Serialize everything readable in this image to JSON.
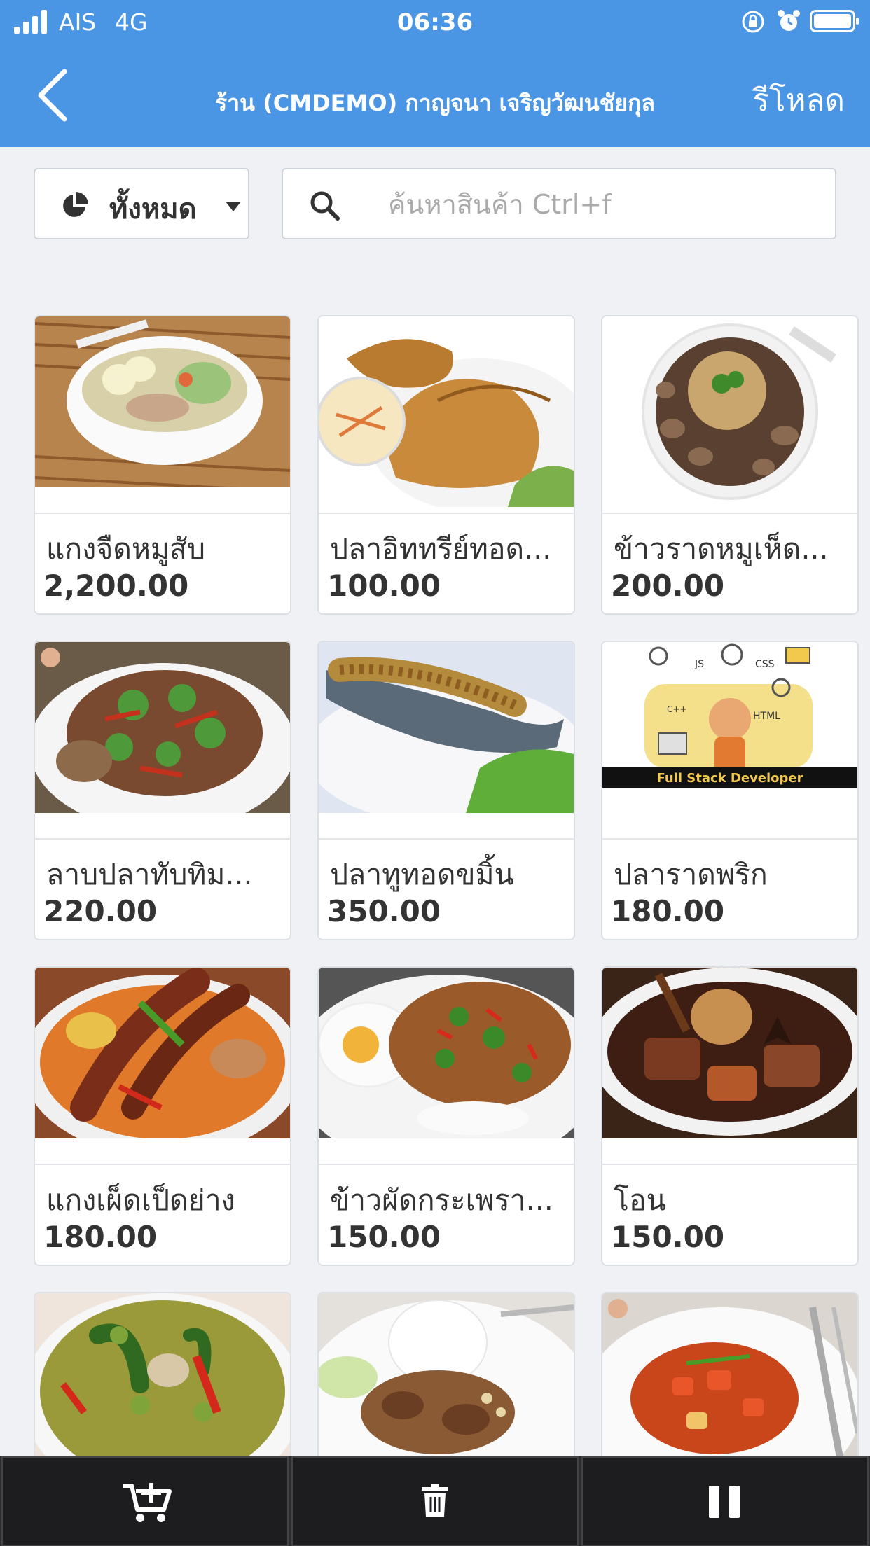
{
  "status_bar": {
    "carrier": "AIS",
    "network": "4G",
    "time": "06:36",
    "icons": [
      "signal-icon",
      "rotation-lock-icon",
      "alarm-icon",
      "battery-icon"
    ]
  },
  "header": {
    "title": "ร้าน (CMDEMO) กาญจนา เจริญวัฒนชัยกุล",
    "reload_label": "รีโหลด",
    "background": "#4a96e4"
  },
  "filter": {
    "selected": "ทั้งหมด"
  },
  "search": {
    "placeholder": "ค้นหาสินค้า Ctrl+f",
    "value": ""
  },
  "products": [
    {
      "name": "แกงจืดหมูสับ",
      "price": "2,200.00"
    },
    {
      "name": "ปลาอิททรีย์ทอด...",
      "price": "100.00"
    },
    {
      "name": "ข้าวราดหมูเห็ด...",
      "price": "200.00"
    },
    {
      "name": "ลาบปลาทับทิม...",
      "price": "220.00"
    },
    {
      "name": "ปลาทูทอดขมิ้น",
      "price": "350.00"
    },
    {
      "name": "ปลาราดพริก",
      "price": "180.00",
      "image_banner": "Full Stack Developer",
      "image_labels": [
        "JS",
        "CSS",
        "HTML",
        "C++"
      ]
    },
    {
      "name": "แกงเผ็ดเป็ดย่าง",
      "price": "180.00"
    },
    {
      "name": "ข้าวผัดกระเพรา...",
      "price": "150.00"
    },
    {
      "name": "โอน",
      "price": "150.00"
    },
    {
      "name": "",
      "price": ""
    },
    {
      "name": "",
      "price": ""
    },
    {
      "name": "",
      "price": ""
    }
  ],
  "bottom_bar": {
    "buttons": [
      "add-to-cart-icon",
      "trash-icon",
      "pause-icon"
    ]
  }
}
